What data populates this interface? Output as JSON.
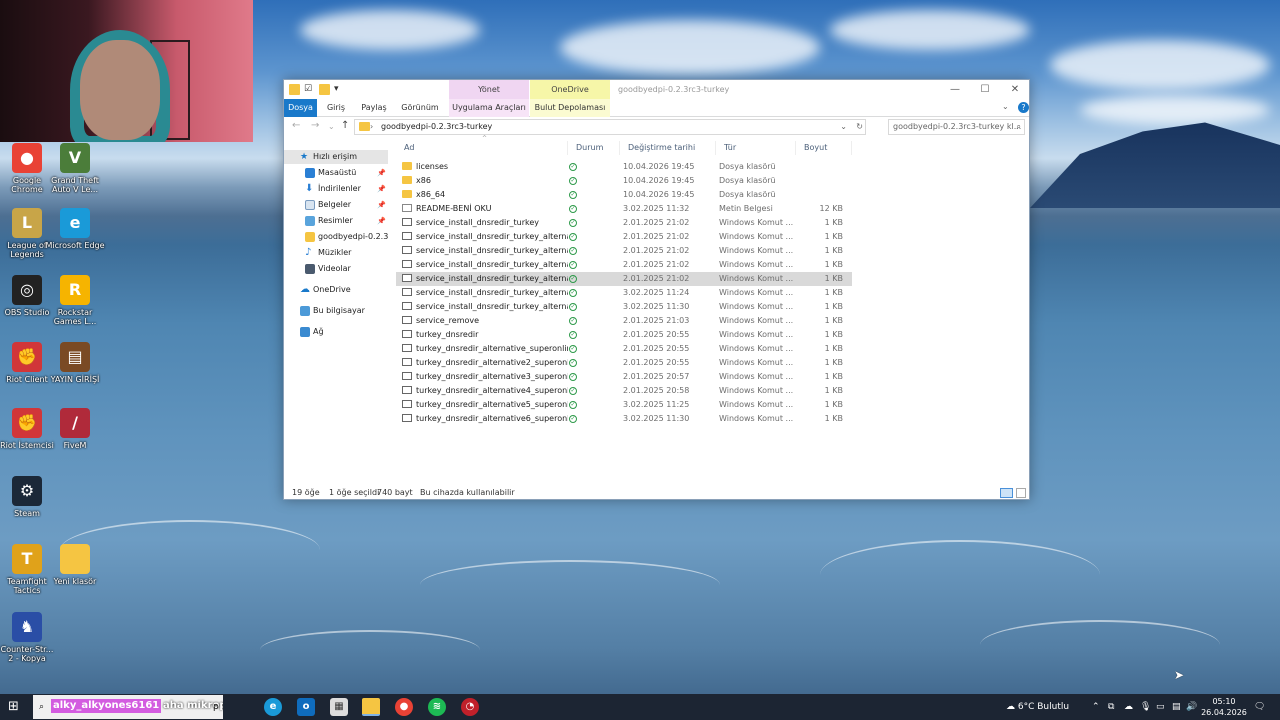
{
  "desktop": {
    "icons": [
      {
        "label": "Google Chrome",
        "icon": "chrome-icon",
        "color": "#e94235",
        "glyph": "●"
      },
      {
        "label": "Grand Theft Auto V Le...",
        "icon": "gta-icon",
        "color": "#4b7d3a",
        "glyph": "V"
      },
      {
        "label": "League of Legends",
        "icon": "league-icon",
        "color": "#c8a548",
        "glyph": "L"
      },
      {
        "label": "Microsoft Edge",
        "icon": "edge-icon",
        "color": "#1a9ad8",
        "glyph": "e"
      },
      {
        "label": "OBS Studio",
        "icon": "obs-icon",
        "color": "#222",
        "glyph": "◎"
      },
      {
        "label": "Rockstar Games L...",
        "icon": "rockstar-icon",
        "color": "#f6b400",
        "glyph": "R"
      },
      {
        "label": "Riot Client",
        "icon": "riot-icon",
        "color": "#d13639",
        "glyph": "✊"
      },
      {
        "label": "YAYIN GİRİŞİ",
        "icon": "chest-icon",
        "color": "#7a4a24",
        "glyph": "▤"
      },
      {
        "label": "Riot İstemcisi",
        "icon": "riot-icon",
        "color": "#d13639",
        "glyph": "✊"
      },
      {
        "label": "FiveM",
        "icon": "fivem-icon",
        "color": "#b02a3a",
        "glyph": "/"
      },
      {
        "label": "Steam",
        "icon": "steam-icon",
        "color": "#1b2838",
        "glyph": "⚙"
      },
      {
        "label": "Teamfight Tactics",
        "icon": "tft-icon",
        "color": "#e0a21a",
        "glyph": "T"
      },
      {
        "label": "Yeni klasör",
        "icon": "folder-icon",
        "color": "#f5c542",
        "glyph": ""
      },
      {
        "label": "Counter-Str... 2 - Kopya",
        "icon": "cs2-icon",
        "color": "#2a4ea6",
        "glyph": "♞"
      }
    ]
  },
  "explorer": {
    "title": "goodbyedpi-0.2.3rc3-turkey",
    "context_tabs": {
      "manage": "Yönet",
      "onedrive": "OneDrive"
    },
    "ribbon_tabs": [
      "Dosya",
      "Giriş",
      "Paylaş",
      "Görünüm",
      "Uygulama Araçları",
      "Bulut Depolaması"
    ],
    "address": "goodbyedpi-0.2.3rc3-turkey",
    "search_placeholder": "goodbyedpi-0.2.3rc3-turkey kl...",
    "nav": {
      "quick_access": "Hızlı erişim",
      "items": [
        "Masaüstü",
        "İndirilenler",
        "Belgeler",
        "Resimler",
        "goodbyedpi-0.2.3rc",
        "Müzikler",
        "Videolar"
      ],
      "onedrive": "OneDrive",
      "this_pc": "Bu bilgisayar",
      "network": "Ağ"
    },
    "columns": {
      "name": "Ad",
      "status": "Durum",
      "date": "Değiştirme tarihi",
      "type": "Tür",
      "size": "Boyut"
    },
    "files": [
      {
        "name": "licenses",
        "kind": "folder",
        "date": "10.04.2026 19:45",
        "type": "Dosya klasörü",
        "size": ""
      },
      {
        "name": "x86",
        "kind": "folder",
        "date": "10.04.2026 19:45",
        "type": "Dosya klasörü",
        "size": ""
      },
      {
        "name": "x86_64",
        "kind": "folder",
        "date": "10.04.2026 19:45",
        "type": "Dosya klasörü",
        "size": ""
      },
      {
        "name": "README-BENİ OKU",
        "kind": "text",
        "date": "3.02.2025 11:32",
        "type": "Metin Belgesi",
        "size": "12 KB"
      },
      {
        "name": "service_install_dnsredir_turkey",
        "kind": "cmd",
        "date": "2.01.2025 21:02",
        "type": "Windows Komut ...",
        "size": "1 KB"
      },
      {
        "name": "service_install_dnsredir_turkey_alternativ...",
        "kind": "cmd",
        "date": "2.01.2025 21:02",
        "type": "Windows Komut ...",
        "size": "1 KB"
      },
      {
        "name": "service_install_dnsredir_turkey_alternativ...",
        "kind": "cmd",
        "date": "2.01.2025 21:02",
        "type": "Windows Komut ...",
        "size": "1 KB"
      },
      {
        "name": "service_install_dnsredir_turkey_alternativ...",
        "kind": "cmd",
        "date": "2.01.2025 21:02",
        "type": "Windows Komut ...",
        "size": "1 KB"
      },
      {
        "name": "service_install_dnsredir_turkey_alternativ...",
        "kind": "cmd",
        "date": "2.01.2025 21:02",
        "type": "Windows Komut ...",
        "size": "1 KB",
        "selected": true
      },
      {
        "name": "service_install_dnsredir_turkey_alternativ...",
        "kind": "cmd",
        "date": "3.02.2025 11:24",
        "type": "Windows Komut ...",
        "size": "1 KB"
      },
      {
        "name": "service_install_dnsredir_turkey_alternativ...",
        "kind": "cmd",
        "date": "3.02.2025 11:30",
        "type": "Windows Komut ...",
        "size": "1 KB"
      },
      {
        "name": "service_remove",
        "kind": "cmd",
        "date": "2.01.2025 21:03",
        "type": "Windows Komut ...",
        "size": "1 KB"
      },
      {
        "name": "turkey_dnsredir",
        "kind": "cmd",
        "date": "2.01.2025 20:55",
        "type": "Windows Komut ...",
        "size": "1 KB"
      },
      {
        "name": "turkey_dnsredir_alternative_superonline",
        "kind": "cmd",
        "date": "2.01.2025 20:55",
        "type": "Windows Komut ...",
        "size": "1 KB"
      },
      {
        "name": "turkey_dnsredir_alternative2_superonline",
        "kind": "cmd",
        "date": "2.01.2025 20:55",
        "type": "Windows Komut ...",
        "size": "1 KB"
      },
      {
        "name": "turkey_dnsredir_alternative3_superonline",
        "kind": "cmd",
        "date": "2.01.2025 20:57",
        "type": "Windows Komut ...",
        "size": "1 KB"
      },
      {
        "name": "turkey_dnsredir_alternative4_superonline",
        "kind": "cmd",
        "date": "2.01.2025 20:58",
        "type": "Windows Komut ...",
        "size": "1 KB"
      },
      {
        "name": "turkey_dnsredir_alternative5_superonline",
        "kind": "cmd",
        "date": "3.02.2025 11:25",
        "type": "Windows Komut ...",
        "size": "1 KB"
      },
      {
        "name": "turkey_dnsredir_alternative6_superonline",
        "kind": "cmd",
        "date": "3.02.2025 11:30",
        "type": "Windows Komut ...",
        "size": "1 KB"
      }
    ],
    "status": {
      "count": "19 öğe",
      "selected": "1 öğe seçildi",
      "size": "740 bayt",
      "availability": "Bu cihazda kullanılabilir"
    }
  },
  "taskbar": {
    "search_overlay": "alky_alkyones6161",
    "search_overlay2": "aha mikroppppp",
    "search_tail": "p",
    "weather": "6°C Bulutlu",
    "time": "05:10",
    "date": "26.04.2026",
    "apps": [
      "edge-icon",
      "outlook-icon",
      "store-icon",
      "explorer-icon",
      "chrome-icon",
      "spotify-icon",
      "app-icon"
    ]
  }
}
